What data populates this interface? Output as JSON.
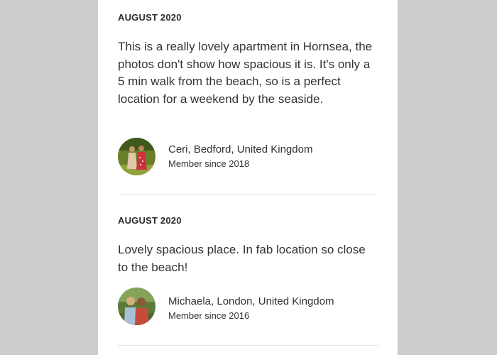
{
  "reviews": [
    {
      "date": "AUGUST 2020",
      "text": "This is a really lovely apartment in Hornsea, the photos don't show how spacious it is. It's only a 5 min walk from the beach, so is a perfect location for a weekend by the seaside.",
      "reviewer_name": "Ceri, Bedford, United Kingdom",
      "member_since": "Member since 2018"
    },
    {
      "date": "AUGUST 2020",
      "text": "Lovely spacious place. In fab location so close to the beach!",
      "reviewer_name": "Michaela, London, United Kingdom",
      "member_since": "Member since 2016"
    }
  ],
  "colors": {
    "page_background": "#cccccc",
    "panel_background": "#ffffff",
    "text": "#333333",
    "divider": "#e6e6e6"
  },
  "icons": {
    "avatar_1": "reviewer-photo-avatar",
    "avatar_2": "reviewer-photo-avatar"
  }
}
